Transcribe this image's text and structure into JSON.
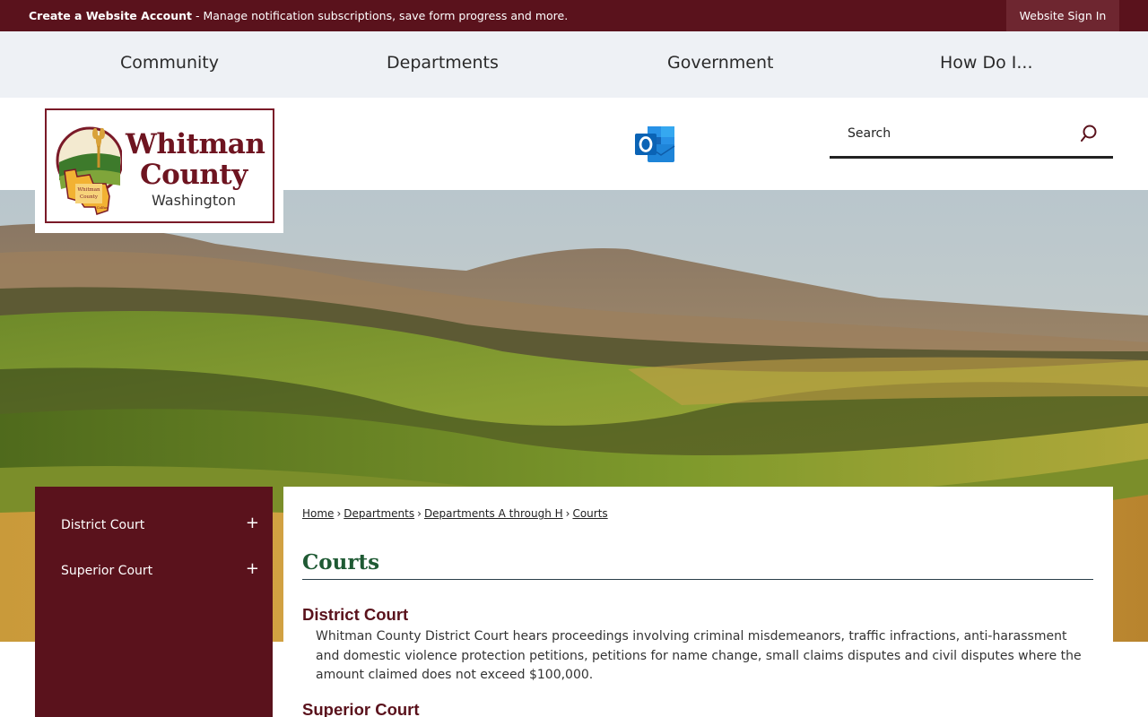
{
  "topbar": {
    "create_account": "Create a Website Account",
    "message": " - Manage notification subscriptions, save form progress and more.",
    "sign_in": "Website Sign In"
  },
  "nav": {
    "items": [
      "Community",
      "Departments",
      "Government",
      "How Do I..."
    ]
  },
  "logo": {
    "line1": "Whitman",
    "line2": "County",
    "line3": "Washington",
    "emblem_text1": "Whitman",
    "emblem_text2": "County",
    "emblem_text3": "Colfax"
  },
  "search": {
    "placeholder": "Search"
  },
  "sidebar": {
    "items": [
      {
        "label": "District Court",
        "toggle": "+"
      },
      {
        "label": "Superior Court",
        "toggle": "+"
      }
    ]
  },
  "breadcrumb": {
    "items": [
      "Home",
      "Departments",
      "Departments A through H",
      "Courts"
    ],
    "separator": "›"
  },
  "main": {
    "title": "Courts",
    "sections": [
      {
        "heading": "District Court",
        "body": "Whitman County District Court hears proceedings involving criminal misdemeanors, traffic infractions, anti-harassment and domestic violence protection petitions, petitions for name change, small claims disputes and civil disputes where the amount claimed does not exceed $100,000."
      },
      {
        "heading": "Superior Court"
      }
    ]
  },
  "colors": {
    "brand_maroon": "#5a121c",
    "title_green": "#1f5a34",
    "nav_bg": "#eef1f5"
  }
}
